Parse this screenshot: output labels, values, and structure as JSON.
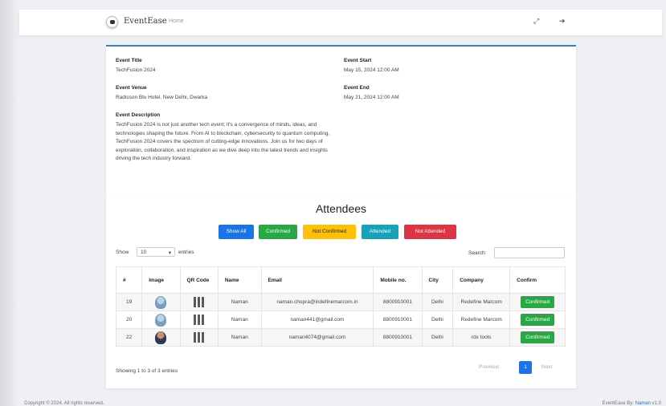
{
  "navbar": {
    "brand": "EventEase",
    "home": "Home",
    "icon1": "expand-icon",
    "icon2": "logout-icon"
  },
  "event": {
    "title_label": "Event Title",
    "title": "TechFusion 2024",
    "venue_label": "Event Venue",
    "venue": "Radisson Blu Hotel, New Delhi, Dwarka",
    "start_label": "Event Start",
    "start": "May 15, 2024 12:00 AM",
    "end_label": "Event End",
    "end": "May 21, 2024 12:00 AM",
    "desc_label": "Event Description",
    "description": "TechFusion 2024 is not just another tech event; it's a convergence of minds, ideas, and technologies shaping the future. From AI to blockchain, cybersecurity to quantum computing, TechFusion 2024 covers the spectrum of cutting-edge innovations. Join us for two days of exploration, collaboration, and inspiration as we dive deep into the latest trends and insights driving the tech industry forward."
  },
  "attendees": {
    "title": "Attendees",
    "filters": [
      "Show All",
      "Confirmed",
      "Not Confirmed",
      "Attended",
      "Not Attended"
    ],
    "filter_colors": [
      "#1b73e8",
      "#28a745",
      "#ffc107",
      "#17a2b8",
      "#dc3545"
    ],
    "show_label": "Show",
    "entries_value": "10",
    "entries_label": "entries",
    "search_label": "Search:",
    "columns": [
      "#",
      "Image",
      "QR Code",
      "Name",
      "Email",
      "Mobile no.",
      "City",
      "Company",
      "Confirm"
    ],
    "rows": [
      {
        "id": "19",
        "name": "Naman",
        "email": "naman.chopra@indefinemarcom.in",
        "mobile": "8800910001",
        "city": "Delhi",
        "company": "Redefine Marcom",
        "confirm": "Confirmed",
        "avatar": "avatar-icon"
      },
      {
        "id": "20",
        "name": "Naman",
        "email": "naman441@gmail.com",
        "mobile": "8800910001",
        "city": "Delhi",
        "company": "Redefine Marcom",
        "confirm": "Confirmed",
        "avatar": "avatar-icon"
      },
      {
        "id": "22",
        "name": "Naman",
        "email": "naman4074@gmail.com",
        "mobile": "8800910001",
        "city": "Delhi",
        "company": "rdx tools",
        "confirm": "Confirmed",
        "avatar": "man-avatar-icon"
      }
    ],
    "info": "Showing 1 to 3 of 3 entries",
    "prev": "Previous",
    "page": "1",
    "next": "Next"
  },
  "footer": {
    "copyright": "Copyright © 2024. All rights reserved.",
    "made_by_prefix": "EventEase By:",
    "made_by_name": "Naman",
    "version": "v1.0"
  }
}
